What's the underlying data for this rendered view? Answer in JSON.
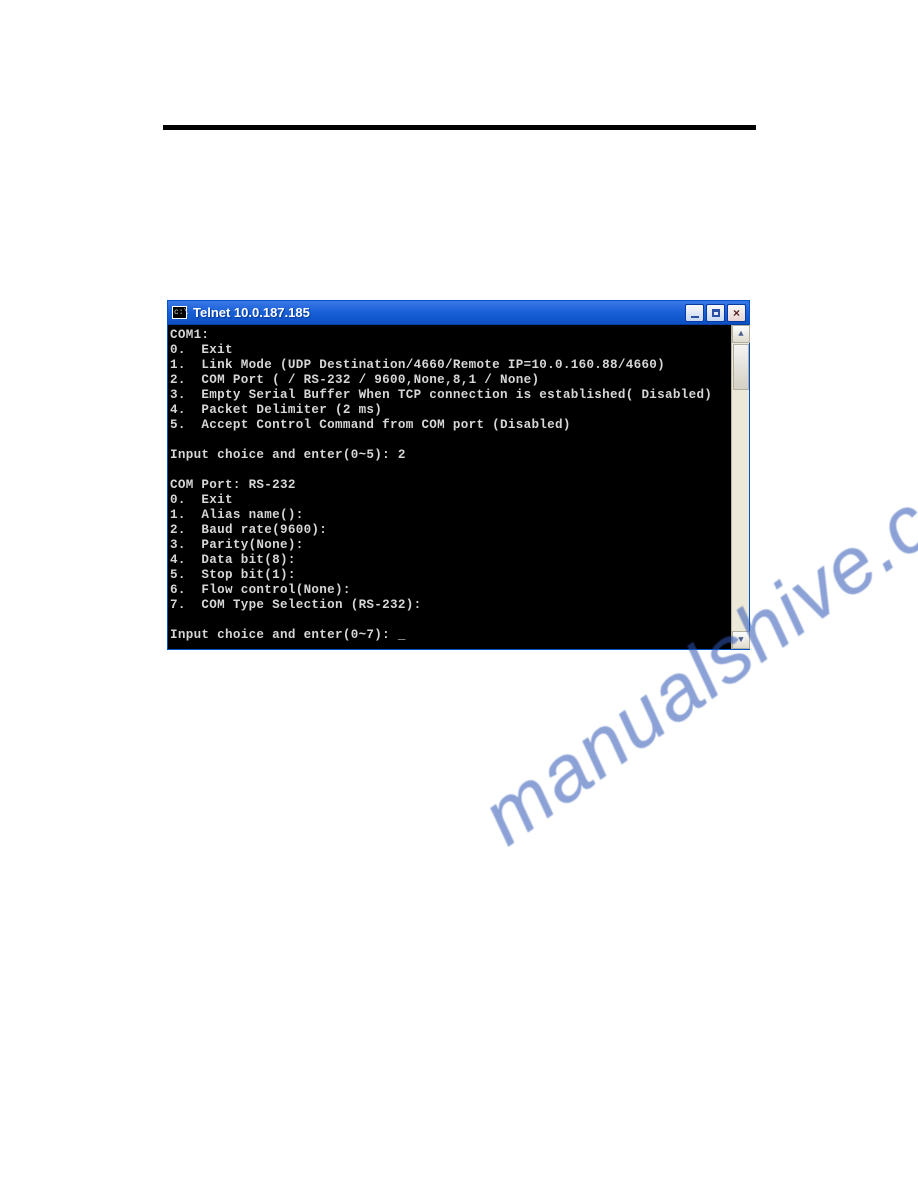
{
  "watermark_text": "manualshive.com",
  "window": {
    "icon_label": "c:\\",
    "title": "Telnet 10.0.187.185",
    "buttons": {
      "minimize": "_",
      "maximize": "□",
      "close": "×"
    }
  },
  "terminal": {
    "lines": [
      "COM1:",
      "0.  Exit",
      "1.  Link Mode (UDP Destination/4660/Remote IP=10.0.160.88/4660)",
      "2.  COM Port ( / RS-232 / 9600,None,8,1 / None)",
      "3.  Empty Serial Buffer When TCP connection is established( Disabled)",
      "4.  Packet Delimiter (2 ms)",
      "5.  Accept Control Command from COM port (Disabled)",
      "",
      "Input choice and enter(0~5): 2",
      "",
      "COM Port: RS-232",
      "0.  Exit",
      "1.  Alias name():",
      "2.  Baud rate(9600):",
      "3.  Parity(None):",
      "4.  Data bit(8):",
      "5.  Stop bit(1):",
      "6.  Flow control(None):",
      "7.  COM Type Selection (RS-232):",
      "",
      "Input choice and enter(0~7): _"
    ]
  }
}
